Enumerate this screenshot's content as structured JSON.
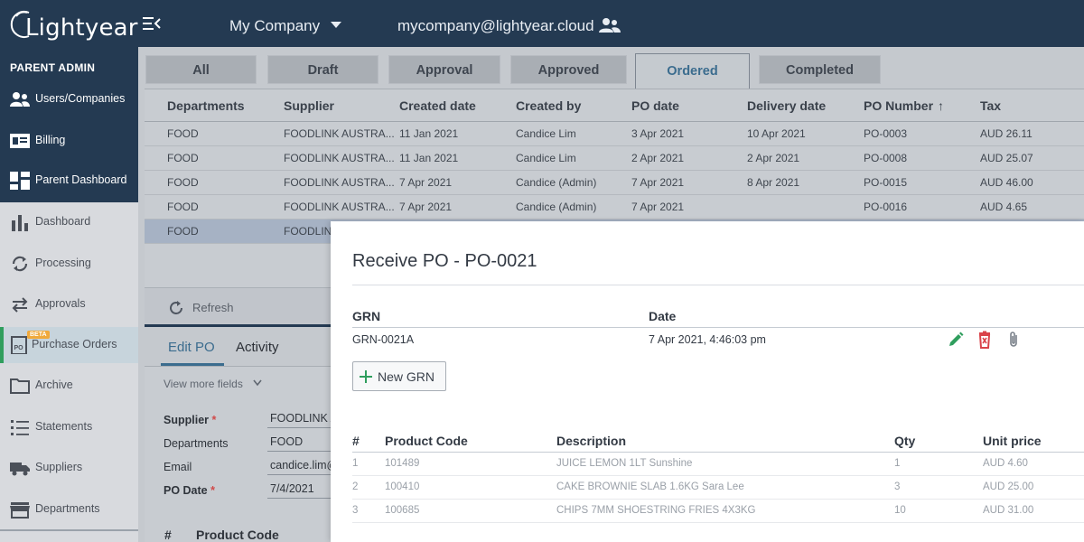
{
  "header": {
    "logo_text": "Lightyear",
    "company": "My Company",
    "email": "mycompany@lightyear.cloud"
  },
  "sidebar": {
    "section_title": "PARENT ADMIN",
    "parent_items": [
      {
        "label": "Users/Companies",
        "icon": "users-icon"
      },
      {
        "label": "Billing",
        "icon": "billing-icon"
      },
      {
        "label": "Parent Dashboard",
        "icon": "dashboard-grid-icon"
      }
    ],
    "items": [
      {
        "label": "Dashboard",
        "icon": "bar-chart-icon"
      },
      {
        "label": "Processing",
        "icon": "sync-icon"
      },
      {
        "label": "Approvals",
        "icon": "swap-arrows-icon"
      },
      {
        "label": "Purchase Orders",
        "icon": "po-doc-icon",
        "badge": "BETA"
      },
      {
        "label": "Archive",
        "icon": "folder-icon"
      },
      {
        "label": "Statements",
        "icon": "list-icon"
      },
      {
        "label": "Suppliers",
        "icon": "truck-icon"
      },
      {
        "label": "Departments",
        "icon": "store-icon"
      }
    ]
  },
  "tabs": [
    "All",
    "Draft",
    "Approval",
    "Approved",
    "Ordered",
    "Completed"
  ],
  "selected_tab": "Ordered",
  "table": {
    "columns": [
      "Departments",
      "Supplier",
      "Created date",
      "Created by",
      "PO date",
      "Delivery date",
      "PO Number",
      "Tax"
    ],
    "sort_indicator": "↑",
    "rows": [
      [
        "FOOD",
        "FOODLINK AUSTRA...",
        "11 Jan 2021",
        "Candice Lim",
        "3 Apr 2021",
        "10 Apr 2021",
        "PO-0003",
        "AUD 26.11"
      ],
      [
        "FOOD",
        "FOODLINK AUSTRA...",
        "11 Jan 2021",
        "Candice Lim",
        "2 Apr 2021",
        "2 Apr 2021",
        "PO-0008",
        "AUD 25.07"
      ],
      [
        "FOOD",
        "FOODLINK AUSTRA...",
        "7 Apr 2021",
        "Candice (Admin)",
        "7 Apr 2021",
        "8 Apr 2021",
        "PO-0015",
        "AUD 46.00"
      ],
      [
        "FOOD",
        "FOODLINK AUSTRA...",
        "7 Apr 2021",
        "Candice (Admin)",
        "7 Apr 2021",
        "",
        "PO-0016",
        "AUD 4.65"
      ],
      [
        "FOOD",
        "FOODLIN",
        "",
        "",
        "",
        "",
        "",
        ""
      ]
    ]
  },
  "refresh_label": "Refresh",
  "subtabs": {
    "edit": "Edit PO",
    "activity": "Activity"
  },
  "form": {
    "view_more": "View more fields",
    "supplier_label": "Supplier",
    "supplier_value": "FOODLINK A",
    "departments_label": "Departments",
    "departments_value": "FOOD",
    "email_label": "Email",
    "email_value": "candice.lim@",
    "po_date_label": "PO Date",
    "po_date_value": "7/4/2021",
    "required_mark": "*",
    "product_hash": "#",
    "product_code": "Product Code"
  },
  "modal": {
    "title": "Receive PO - PO-0021",
    "grn_header": "GRN",
    "date_header": "Date",
    "grn_value": "GRN-0021A",
    "date_value": "7 Apr 2021, 4:46:03 pm",
    "new_grn": "New GRN",
    "products_columns": [
      "#",
      "Product Code",
      "Description",
      "Qty",
      "Unit price"
    ],
    "products": [
      [
        "1",
        "101489",
        "JUICE LEMON 1LT Sunshine",
        "1",
        "AUD 4.60"
      ],
      [
        "2",
        "100410",
        "CAKE BROWNIE SLAB 1.6KG Sara Lee",
        "3",
        "AUD 25.00"
      ],
      [
        "3",
        "100685",
        "CHIPS 7MM SHOESTRING FRIES 4X3KG",
        "10",
        "AUD 31.00"
      ]
    ]
  },
  "colors": {
    "brand_navy": "#243a52",
    "accent_blue": "#3b6c8e",
    "active_green": "#2f9e5d",
    "edit_green": "#2f9e5d",
    "delete_red": "#d9434a"
  }
}
